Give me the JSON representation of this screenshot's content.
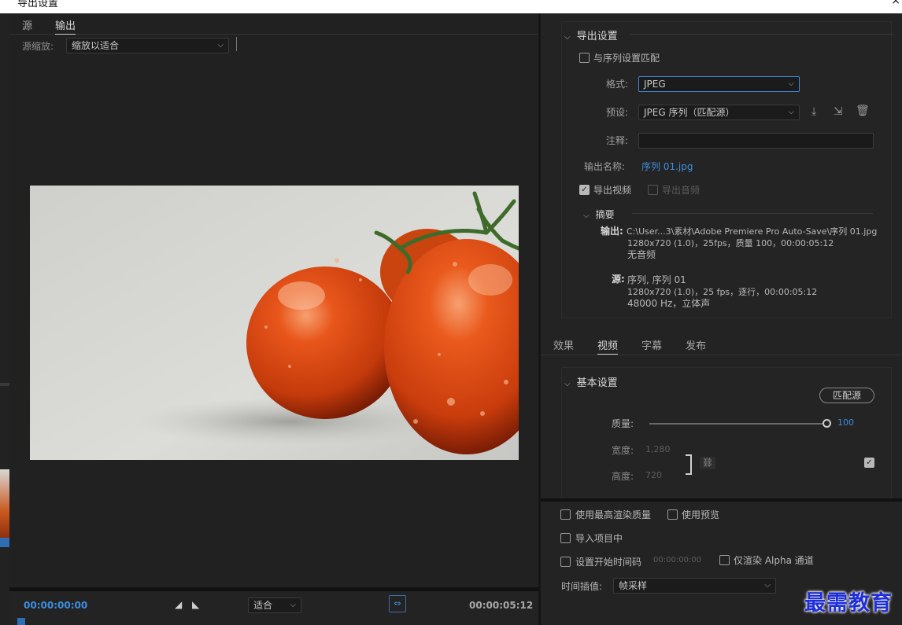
{
  "window": {
    "title": "导出设置",
    "close_glyph": "×"
  },
  "left": {
    "tabs": [
      {
        "label": "源"
      },
      {
        "label": "输出"
      }
    ],
    "source_scale": {
      "label": "源缩放:",
      "value": "缩放以适合"
    },
    "bottom": {
      "start_tc": "00:00:00:00",
      "end_tc": "00:00:05:12",
      "zoom_value": "适合"
    }
  },
  "export": {
    "header": "导出设置",
    "match_sequence_label": "与序列设置匹配",
    "format_label": "格式:",
    "format_value": "JPEG",
    "preset_label": "预设:",
    "preset_value": "JPEG 序列（匹配源）",
    "comment_label": "注释:",
    "output_name_label": "输出名称:",
    "output_name_value": "序列 01.jpg",
    "export_video_label": "导出视频",
    "export_audio_label": "导出音频",
    "summary": {
      "header": "摘要",
      "output_label": "输出:",
      "output_line1": "C:\\User...3\\素材\\Adobe Premiere Pro Auto-Save\\序列 01.jpg",
      "output_line2": "1280x720 (1.0)，25fps，质量 100，00:00:05:12",
      "output_line3": "无音频",
      "source_label": "源:",
      "source_line1": "序列, 序列 01",
      "source_line2": "1280x720 (1.0)，25 fps，逐行，00:00:05:12",
      "source_line3": "48000 Hz，立体声"
    }
  },
  "tabs_mid": [
    {
      "label": "效果"
    },
    {
      "label": "视频"
    },
    {
      "label": "字幕"
    },
    {
      "label": "发布"
    }
  ],
  "basic": {
    "header": "基本设置",
    "match_source_btn": "匹配源",
    "quality_label": "质量:",
    "quality_value": "100",
    "quality_level": 1.0,
    "width_label": "宽度:",
    "width_value": "1,280",
    "height_label": "高度:",
    "height_value": "720"
  },
  "bottom_options": {
    "max_render_label": "使用最高渲染质量",
    "use_preview_label": "使用预览",
    "import_project_label": "导入项目中",
    "set_start_tc_label": "设置开始时间码",
    "start_tc_value": "00:00:00:00",
    "alpha_only_label": "仅渲染 Alpha 通道",
    "time_interp_label": "时间插值:",
    "time_interp_value": "帧采样"
  },
  "watermark": "最需教育",
  "icons": [
    "close-icon",
    "chevron-down-icon",
    "save-preset-icon",
    "import-preset-icon",
    "trash-icon",
    "link-icon",
    "mark-in-icon",
    "mark-out-icon",
    "fit-frame-icon",
    "playhead-icon"
  ]
}
